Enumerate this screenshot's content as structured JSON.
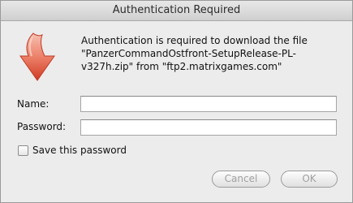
{
  "window": {
    "title": "Authentication Required"
  },
  "dialog": {
    "icon": "download-arrow-icon",
    "message_lines": [
      "Authentication is required to download the file",
      "\"PanzerCommandOstfront-SetupRelease-PL-",
      "v327h.zip\" from \"ftp2.matrixgames.com\""
    ]
  },
  "form": {
    "name_label": "Name:",
    "name_value": "",
    "password_label": "Password:",
    "password_value": "",
    "save_password_label": "Save this password",
    "save_password_checked": false
  },
  "buttons": {
    "cancel": "Cancel",
    "ok": "OK"
  },
  "colors": {
    "icon_red": "#d23b27",
    "icon_light": "#f4a08b",
    "disabled_text": "#a0a0a0"
  }
}
